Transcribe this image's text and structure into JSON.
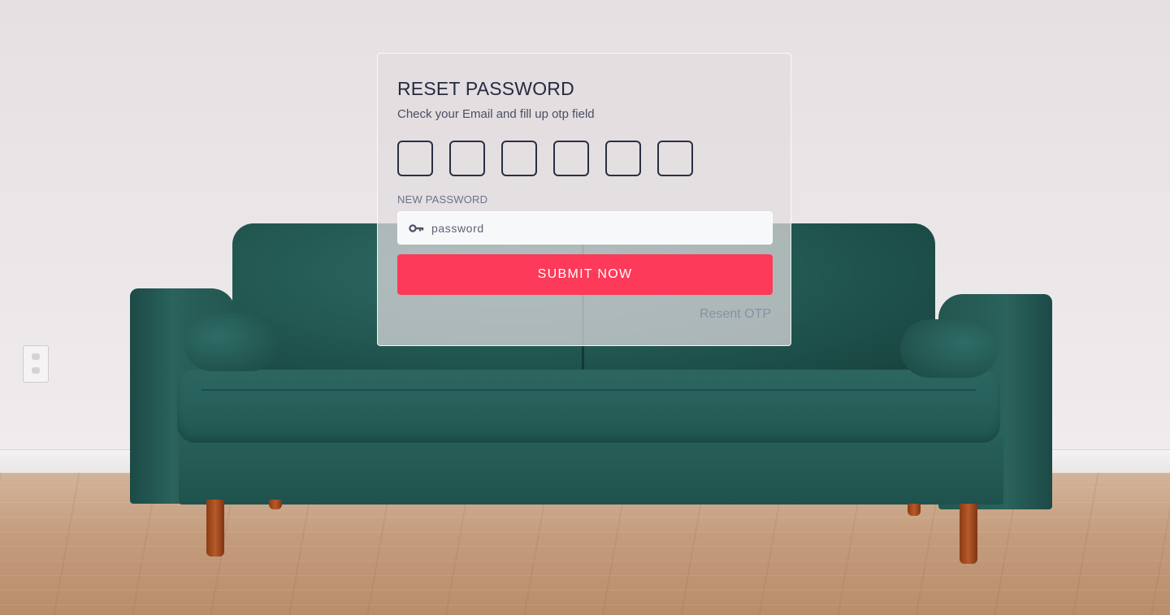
{
  "form": {
    "title": "RESET PASSWORD",
    "subtitle": "Check your Email and fill up otp field",
    "otp_digits": [
      "",
      "",
      "",
      "",
      "",
      ""
    ],
    "new_password_label": "NEW PASSWORD",
    "password_placeholder": "password",
    "password_icon": "key-icon",
    "submit_label": "SUBMIT NOW",
    "resend_link": "Resent OTP"
  },
  "background": {
    "description_icon": "sofa-scene"
  },
  "colors": {
    "accent": "#fd3a59",
    "title": "#262b40",
    "link": "#8790a6",
    "sofa": "#27605a"
  }
}
